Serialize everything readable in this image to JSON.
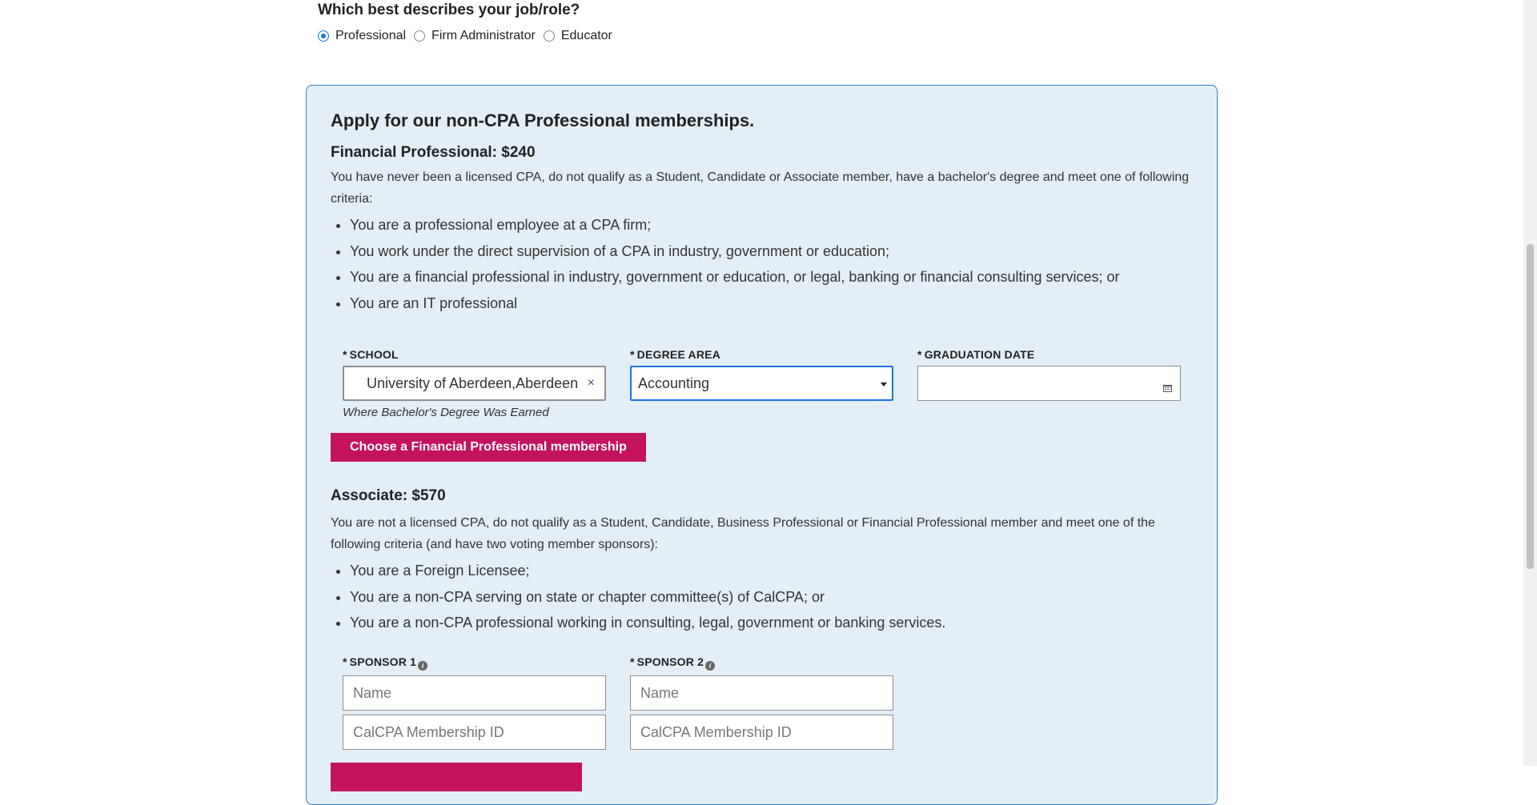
{
  "job_role": {
    "question": "Which best describes your job/role?",
    "options": [
      {
        "label": "Professional",
        "checked": true
      },
      {
        "label": "Firm Administrator",
        "checked": false
      },
      {
        "label": "Educator",
        "checked": false
      }
    ]
  },
  "panel": {
    "heading": "Apply for our non-CPA Professional memberships.",
    "financial": {
      "title": "Financial Professional: $240",
      "description": "You have never been a licensed CPA, do not qualify as a Student, Candidate or Associate member, have a bachelor's degree and meet one of following criteria:",
      "criteria": [
        "You are a professional employee at a CPA firm;",
        "You work under the direct supervision of a CPA in industry, government or education;",
        "You are a financial professional in industry, government or education, or legal, banking or financial consulting services; or",
        "You are an IT professional"
      ],
      "school": {
        "required_mark": "*",
        "label": "SCHOOL",
        "value": "University of Aberdeen,Aberdeen",
        "clear": "×",
        "hint": "Where Bachelor's Degree Was Earned"
      },
      "degree_area": {
        "required_mark": "*",
        "label": "DEGREE AREA",
        "value": "Accounting"
      },
      "graduation_date": {
        "required_mark": "*",
        "label": "GRADUATION DATE",
        "value": ""
      },
      "choose_button": "Choose a Financial Professional membership"
    },
    "associate": {
      "title": "Associate: $570",
      "description": "You are not a licensed CPA, do not qualify as a Student, Candidate, Business Professional or Financial Professional member and meet one of the following criteria (and have two voting member sponsors):",
      "criteria": [
        "You are a Foreign Licensee;",
        "You are a non-CPA serving on state or chapter committee(s) of CalCPA; or",
        "You are a non-CPA professional working in consulting, legal, government or banking services."
      ],
      "sponsor1": {
        "required_mark": "*",
        "label": "SPONSOR 1",
        "info": "i",
        "name_placeholder": "Name",
        "id_placeholder": "CalCPA Membership ID"
      },
      "sponsor2": {
        "required_mark": "*",
        "label": "SPONSOR 2",
        "info": "i",
        "name_placeholder": "Name",
        "id_placeholder": "CalCPA Membership ID"
      }
    }
  },
  "colors": {
    "accent_pink": "#c4135e",
    "panel_bg": "#e3eef7",
    "panel_border": "#2f80c7",
    "focus_blue": "#1a73e8"
  },
  "icons": {
    "graduation_date": "calendar-icon",
    "degree_area": "caret-down-icon",
    "school": "clear-icon",
    "sponsor": "info-icon"
  }
}
